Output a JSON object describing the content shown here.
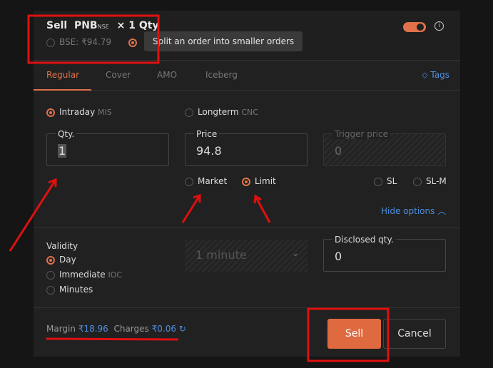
{
  "header": {
    "action": "Sell",
    "symbol": "PNB",
    "exchange": "NSE",
    "qty_text": "× 1 Qty",
    "bse_label": "BSE: ₹94.79",
    "tooltip": "Split an order into smaller orders"
  },
  "tabs": [
    "Regular",
    "Cover",
    "AMO",
    "Iceberg"
  ],
  "tags_label": "Tags",
  "product": {
    "intraday": "Intraday",
    "intraday_code": "MIS",
    "longterm": "Longterm",
    "longterm_code": "CNC"
  },
  "fields": {
    "qty_label": "Qty.",
    "qty_value": "1",
    "price_label": "Price",
    "price_value": "94.8",
    "trigger_label": "Trigger price",
    "trigger_value": "0"
  },
  "order_types": {
    "market": "Market",
    "limit": "Limit",
    "sl": "SL",
    "slm": "SL-M"
  },
  "hide_options": "Hide options",
  "validity": {
    "label": "Validity",
    "day": "Day",
    "immediate": "Immediate",
    "immediate_code": "IOC",
    "minutes": "Minutes",
    "minutes_select": "1 minute"
  },
  "disclosed": {
    "label": "Disclosed qty.",
    "value": "0"
  },
  "footer": {
    "margin_label": "Margin",
    "margin_value": "₹18.96",
    "charges_label": "Charges",
    "charges_value": "₹0.06",
    "sell": "Sell",
    "cancel": "Cancel"
  },
  "colors": {
    "accent": "#e0714a",
    "link": "#4d8fe0",
    "annotation": "#e01010"
  }
}
